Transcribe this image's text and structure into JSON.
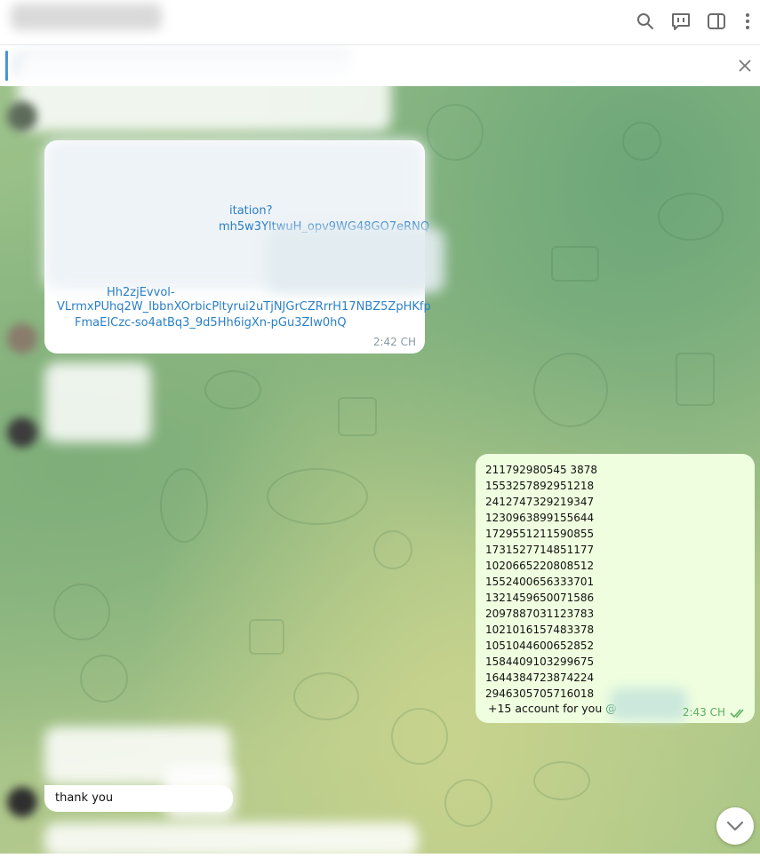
{
  "header": {
    "icons": [
      "search-icon",
      "topics-icon",
      "sidebar-icon",
      "more-icon"
    ]
  },
  "pinned": {
    "close_icon": "close-icon"
  },
  "incoming_link": {
    "lines": [
      "itation?",
      "mh5w3YltwuH_opv9WG48GO7eRNQ",
      "Hh2zjEvvol-",
      "VLrmxPUhq2W_IbbnXOrbicPltyrui2uTjNJGrCZRrrH17NBZ5ZpHKfpQ",
      "FmaEICzc-so4atBq3_9d5Hh6igXn-pGu3ZIw0hQ"
    ],
    "time": "2:42 CH"
  },
  "outgoing": {
    "numbers": [
      "211792980545 3878",
      "1553257892951218",
      "2412747329219347",
      "1230963899155644",
      "1729551211590855",
      "1731527714851177",
      "1020665220808512",
      "1552400656333701",
      "1321459650071586",
      "2097887031123783",
      "1021016157483378",
      "1051044600652852",
      "1584409103299675",
      "1644384723874224",
      "2946305705716018"
    ],
    "text": "+15 account for you",
    "mention": "@",
    "time": "2:43 CH"
  },
  "reply": {
    "text": "thank you"
  },
  "colors": {
    "accent": "#3a8fd6",
    "outgoing_bg": "#eefedf",
    "link": "#2a7fc7",
    "time_out": "#5fae5e"
  }
}
